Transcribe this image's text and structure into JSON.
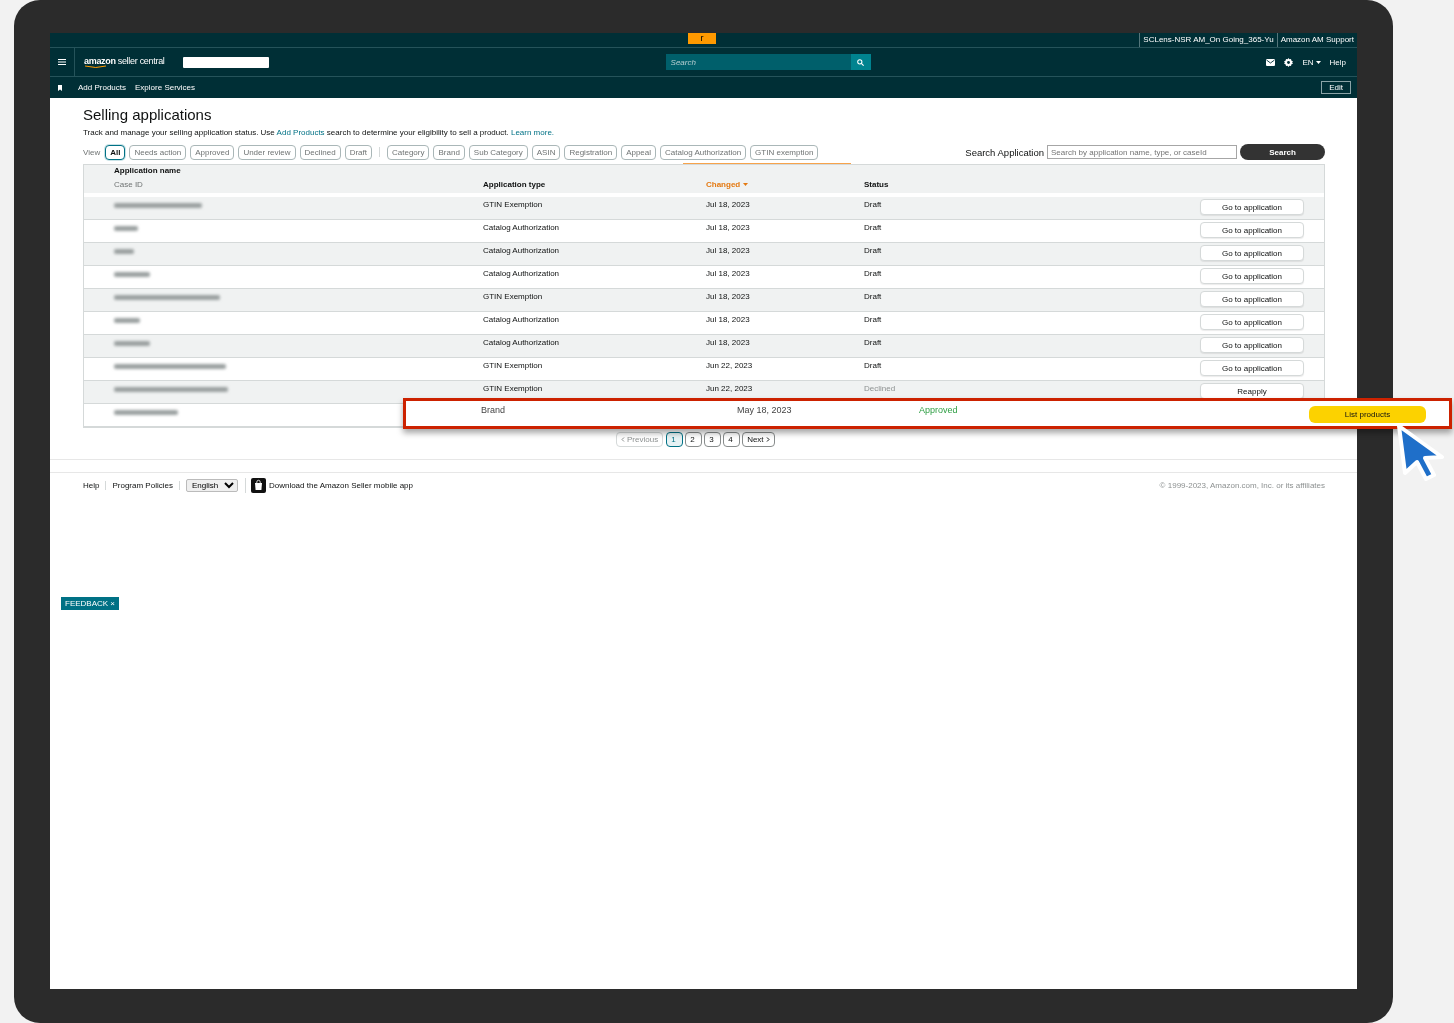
{
  "top_strip": {
    "tab": "r",
    "account_links": [
      "SCLens-NSR AM_On Going_365-Yu",
      "Amazon AM Support"
    ]
  },
  "nav": {
    "logo_brand": "amazon",
    "logo_product": "seller central",
    "search_placeholder": "Search",
    "language": "EN",
    "help": "Help"
  },
  "subnav": {
    "links": [
      "Add Products",
      "Explore Services"
    ],
    "edit": "Edit"
  },
  "page": {
    "title": "Selling applications",
    "description": [
      {
        "text": "Track and manage your selling application status. Use ",
        "link": false
      },
      {
        "text": "Add Products",
        "link": true
      },
      {
        "text": " search to determine your eligibility to sell a product. ",
        "link": false
      },
      {
        "text": "Learn more.",
        "link": true
      }
    ]
  },
  "filters": {
    "view_label": "View",
    "status_filters": [
      {
        "label": "All",
        "selected": true
      },
      {
        "label": "Needs action",
        "selected": false
      },
      {
        "label": "Approved",
        "selected": false
      },
      {
        "label": "Under review",
        "selected": false
      },
      {
        "label": "Declined",
        "selected": false
      },
      {
        "label": "Draft",
        "selected": false
      }
    ],
    "type_filters": [
      {
        "label": "Category",
        "selected": false
      },
      {
        "label": "Brand",
        "selected": false
      },
      {
        "label": "Sub Category",
        "selected": false
      },
      {
        "label": "ASIN",
        "selected": false
      },
      {
        "label": "Registration",
        "selected": false
      },
      {
        "label": "Appeal",
        "selected": false
      },
      {
        "label": "Catalog Authorization",
        "selected": false
      },
      {
        "label": "GTIN exemption",
        "selected": false
      }
    ],
    "search_label": "Search Application",
    "search_placeholder": "Search by application name, type, or caseId",
    "search_button": "Search"
  },
  "table": {
    "columns": {
      "name": "Application name",
      "case_id": "Case ID",
      "type": "Application type",
      "changed": "Changed",
      "status": "Status"
    },
    "rows": [
      {
        "type": "GTIN Exemption",
        "changed": "Jul 18, 2023",
        "status": "Draft",
        "kind": "draft",
        "action": "Go to application"
      },
      {
        "type": "Catalog Authorization",
        "changed": "Jul 18, 2023",
        "status": "Draft",
        "kind": "draft",
        "action": "Go to application"
      },
      {
        "type": "Catalog Authorization",
        "changed": "Jul 18, 2023",
        "status": "Draft",
        "kind": "draft",
        "action": "Go to application"
      },
      {
        "type": "Catalog Authorization",
        "changed": "Jul 18, 2023",
        "status": "Draft",
        "kind": "draft",
        "action": "Go to application"
      },
      {
        "type": "GTIN Exemption",
        "changed": "Jul 18, 2023",
        "status": "Draft",
        "kind": "draft",
        "action": "Go to application"
      },
      {
        "type": "Catalog Authorization",
        "changed": "Jul 18, 2023",
        "status": "Draft",
        "kind": "draft",
        "action": "Go to application"
      },
      {
        "type": "Catalog Authorization",
        "changed": "Jul 18, 2023",
        "status": "Draft",
        "kind": "draft",
        "action": "Go to application"
      },
      {
        "type": "GTIN Exemption",
        "changed": "Jun 22, 2023",
        "status": "Draft",
        "kind": "draft",
        "action": "Go to application"
      },
      {
        "type": "GTIN Exemption",
        "changed": "Jun 22, 2023",
        "status": "Declined",
        "kind": "declined",
        "action": "Reapply"
      }
    ],
    "highlighted_row": {
      "type": "Brand",
      "changed": "May 18, 2023",
      "status": "Approved",
      "kind": "approved",
      "action": "List products"
    }
  },
  "pagination": {
    "previous": "Previous",
    "pages": [
      {
        "label": "1",
        "selected": true
      },
      {
        "label": "2",
        "selected": false
      },
      {
        "label": "3",
        "selected": false
      },
      {
        "label": "4",
        "selected": false
      }
    ],
    "next": "Next"
  },
  "footer": {
    "links": [
      "Help",
      "Program Policies"
    ],
    "language": "English",
    "app_link": "Download the Amazon Seller mobile app",
    "copyright": "© 1999-2023, Amazon.com, Inc. or its affiliates"
  },
  "feedback": {
    "label": "FEEDBACK",
    "close": "×"
  }
}
